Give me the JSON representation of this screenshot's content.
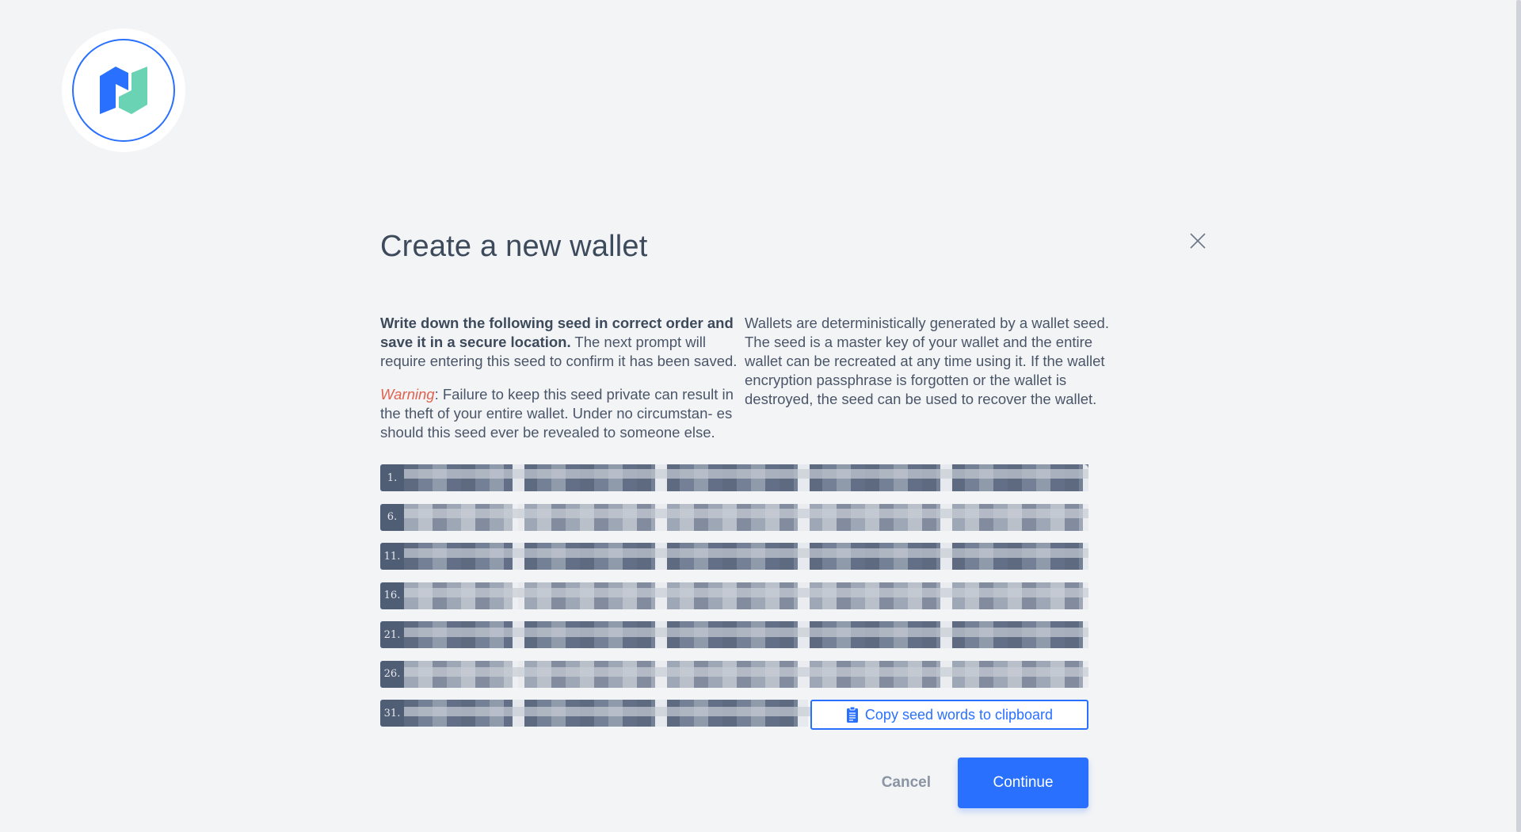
{
  "dialog": {
    "title": "Create a new wallet",
    "left_col": {
      "bold_intro": "Write down the following seed in correct order and save it in a secure location.",
      "intro_rest": " The next prompt will require entering this seed to confirm it has been saved.",
      "warning_label": "Warning",
      "warning_text": ": Failure to keep this seed private can result in the theft of your entire wallet. Under no circumstan- es should this seed ever be revealed to someone else."
    },
    "right_col": {
      "text": "Wallets are deterministically generated by a wallet seed. The seed is a master key of your wallet and the entire wallet can be recreated at any time using it. If the wallet encryption passphrase is forgotten or the wallet is destroyed, the seed can be used to recover the wallet."
    },
    "seed_rows": [
      {
        "label": "1."
      },
      {
        "label": "6."
      },
      {
        "label": "11."
      },
      {
        "label": "16."
      },
      {
        "label": "21."
      },
      {
        "label": "26."
      },
      {
        "label": "31."
      }
    ],
    "copy_button": "Copy seed words to clipboard",
    "cancel_button": "Cancel",
    "continue_button": "Continue"
  },
  "colors": {
    "accent": "#2970ff",
    "logo_blue": "#2970ff",
    "logo_green": "#69d3b3",
    "warning": "#e0624f",
    "background": "#f3f4f6"
  },
  "icons": {
    "logo": "decred-logo",
    "close": "close-icon",
    "clipboard": "clipboard-icon"
  }
}
